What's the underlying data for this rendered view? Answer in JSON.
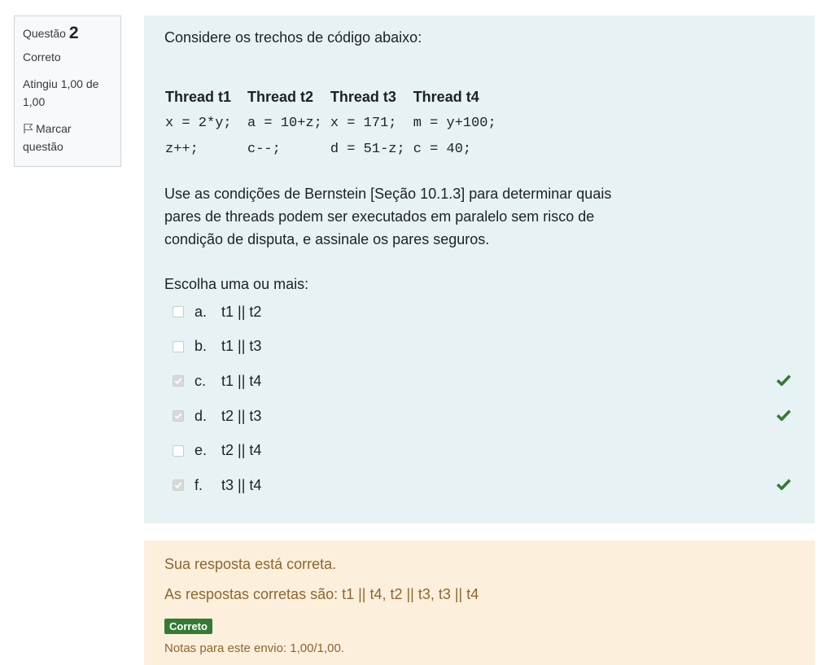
{
  "info": {
    "question_label": "Questão",
    "question_number": "2",
    "state": "Correto",
    "grade": "Atingiu 1,00 de 1,00",
    "flag_label": "Marcar questão"
  },
  "question": {
    "intro": "Considere os trechos de código abaixo:",
    "threads": [
      {
        "name": "Thread t1",
        "line1": "x = 2*y;",
        "line2": "z++;"
      },
      {
        "name": "Thread t2",
        "line1": "a = 10+z;",
        "line2": "c--;"
      },
      {
        "name": "Thread t3",
        "line1": "x = 171;",
        "line2": "d = 51-z;"
      },
      {
        "name": "Thread t4",
        "line1": "m = y+100;",
        "line2": "c = 40;"
      }
    ],
    "instruction": "Use as condições de Bernstein [Seção 10.1.3] para determinar quais pares de threads podem ser executados em paralelo sem risco de condição de disputa, e assinale os pares seguros.",
    "prompt": "Escolha uma ou mais:",
    "options": [
      {
        "letter": "a.",
        "label": "t1 || t2",
        "checked": false,
        "correct": false
      },
      {
        "letter": "b.",
        "label": "t1 || t3",
        "checked": false,
        "correct": false
      },
      {
        "letter": "c.",
        "label": "t1 || t4",
        "checked": true,
        "correct": true
      },
      {
        "letter": "d.",
        "label": "t2 || t3",
        "checked": true,
        "correct": true
      },
      {
        "letter": "e.",
        "label": "t2 || t4",
        "checked": false,
        "correct": false
      },
      {
        "letter": "f.",
        "label": "t3 || t4",
        "checked": true,
        "correct": true
      }
    ]
  },
  "outcome": {
    "feedback": "Sua resposta está correta.",
    "right_answer": "As respostas corretas são: t1 || t4, t2 || t3, t3 || t4",
    "badge": "Correto",
    "marks": "Notas para este envio: 1,00/1,00."
  },
  "colors": {
    "formulation_bg": "#e7f2f4",
    "outcome_bg": "#fcefdc",
    "outcome_text": "#8e662e",
    "correct_green": "#357a32"
  }
}
